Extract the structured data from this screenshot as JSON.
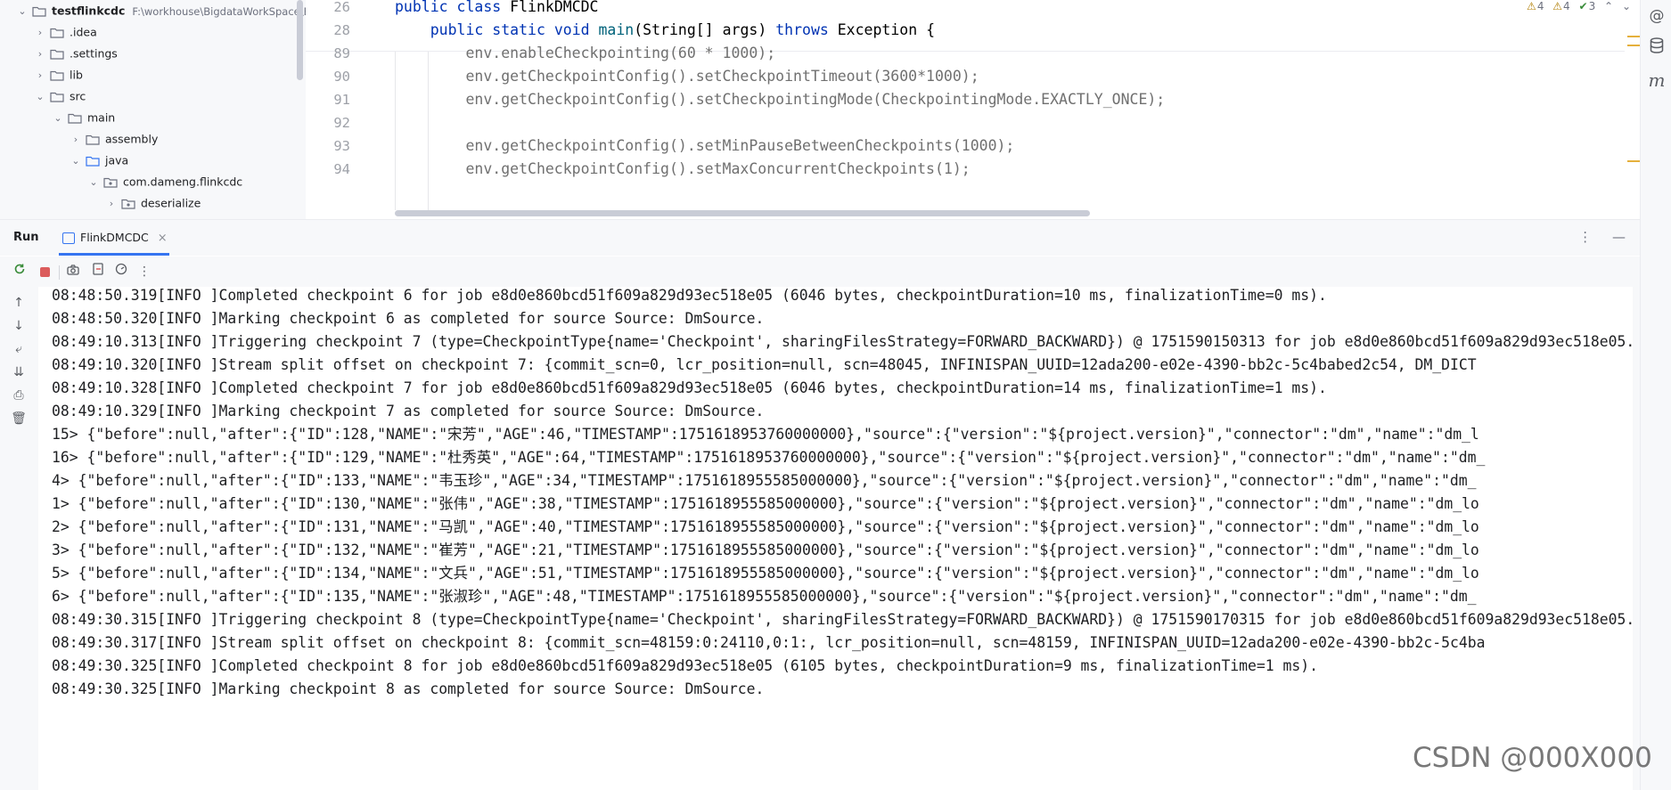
{
  "project_tree": {
    "items": [
      {
        "label": "testflinkcdc",
        "path": "F:\\workhouse\\BigdataWorkSpace\\B",
        "bold": true,
        "expanded": true,
        "kind": "module"
      },
      {
        "label": ".idea",
        "expanded": false,
        "kind": "folder"
      },
      {
        "label": ".settings",
        "expanded": false,
        "kind": "folder"
      },
      {
        "label": "lib",
        "expanded": false,
        "kind": "folder"
      },
      {
        "label": "src",
        "expanded": true,
        "kind": "folder"
      },
      {
        "label": "main",
        "expanded": true,
        "kind": "folder"
      },
      {
        "label": "assembly",
        "expanded": false,
        "kind": "folder"
      },
      {
        "label": "java",
        "expanded": true,
        "kind": "source-folder"
      },
      {
        "label": "com.dameng.flinkcdc",
        "expanded": true,
        "kind": "package"
      },
      {
        "label": "deserialize",
        "expanded": false,
        "kind": "package"
      }
    ]
  },
  "editor": {
    "lines": [
      {
        "num": "26",
        "tokens": [
          {
            "t": "public ",
            "c": "kw"
          },
          {
            "t": "class ",
            "c": "kw"
          },
          {
            "t": "FlinkDMCDC",
            "c": "cls"
          }
        ]
      },
      {
        "num": "28",
        "tokens": [
          {
            "t": "    public ",
            "c": "kw"
          },
          {
            "t": "static ",
            "c": "kw"
          },
          {
            "t": "void ",
            "c": "kw"
          },
          {
            "t": "main",
            "c": "fn"
          },
          {
            "t": "(String[] args) ",
            "c": "cls"
          },
          {
            "t": "throws ",
            "c": "kw"
          },
          {
            "t": "Exception {",
            "c": "cls"
          }
        ]
      },
      {
        "num": "89",
        "tokens": [
          {
            "t": "        env.enableCheckpointing(60 * 1000);",
            "c": "grey"
          }
        ]
      },
      {
        "num": "90",
        "tokens": [
          {
            "t": "        env.getCheckpointConfig().setCheckpointTimeout(3600*1000);",
            "c": "grey"
          }
        ]
      },
      {
        "num": "91",
        "tokens": [
          {
            "t": "        env.getCheckpointConfig().setCheckpointingMode(CheckpointingMode.EXACTLY_ONCE);",
            "c": "grey"
          }
        ]
      },
      {
        "num": "92",
        "tokens": [
          {
            "t": "",
            "c": "grey"
          }
        ]
      },
      {
        "num": "93",
        "tokens": [
          {
            "t": "        env.getCheckpointConfig().setMinPauseBetweenCheckpoints(1000);",
            "c": "grey"
          }
        ]
      },
      {
        "num": "94",
        "tokens": [
          {
            "t": "        env.getCheckpointConfig().setMaxConcurrentCheckpoints(1);",
            "c": "grey"
          }
        ]
      }
    ],
    "inspections": {
      "warnings_a": "4",
      "warnings_b": "4",
      "ok": "3"
    }
  },
  "run_window": {
    "title": "Run",
    "tab_label": "FlinkDMCDC",
    "tab_close": "×"
  },
  "console": {
    "lines": [
      "08:48:50.319[INFO ]Completed checkpoint 6 for job e8d0e860bcd51f609a829d93ec518e05 (6046 bytes, checkpointDuration=10 ms, finalizationTime=0 ms).",
      "08:48:50.320[INFO ]Marking checkpoint 6 as completed for source Source: DmSource.",
      "08:49:10.313[INFO ]Triggering checkpoint 7 (type=CheckpointType{name='Checkpoint', sharingFilesStrategy=FORWARD_BACKWARD}) @ 1751590150313 for job e8d0e860bcd51f609a829d93ec518e05.",
      "08:49:10.320[INFO ]Stream split offset on checkpoint 7: {commit_scn=0, lcr_position=null, scn=48045, INFINISPAN_UUID=12ada200-e02e-4390-bb2c-5c4babed2c54, DM_DICT",
      "08:49:10.328[INFO ]Completed checkpoint 7 for job e8d0e860bcd51f609a829d93ec518e05 (6046 bytes, checkpointDuration=14 ms, finalizationTime=1 ms).",
      "08:49:10.329[INFO ]Marking checkpoint 7 as completed for source Source: DmSource.",
      "15> {\"before\":null,\"after\":{\"ID\":128,\"NAME\":\"宋芳\",\"AGE\":46,\"TIMESTAMP\":1751618953760000000},\"source\":{\"version\":\"${project.version}\",\"connector\":\"dm\",\"name\":\"dm_l",
      "16> {\"before\":null,\"after\":{\"ID\":129,\"NAME\":\"杜秀英\",\"AGE\":64,\"TIMESTAMP\":1751618953760000000},\"source\":{\"version\":\"${project.version}\",\"connector\":\"dm\",\"name\":\"dm_",
      "4> {\"before\":null,\"after\":{\"ID\":133,\"NAME\":\"韦玉珍\",\"AGE\":34,\"TIMESTAMP\":1751618955585000000},\"source\":{\"version\":\"${project.version}\",\"connector\":\"dm\",\"name\":\"dm_",
      "1> {\"before\":null,\"after\":{\"ID\":130,\"NAME\":\"张伟\",\"AGE\":38,\"TIMESTAMP\":1751618955585000000},\"source\":{\"version\":\"${project.version}\",\"connector\":\"dm\",\"name\":\"dm_lo",
      "2> {\"before\":null,\"after\":{\"ID\":131,\"NAME\":\"马凯\",\"AGE\":40,\"TIMESTAMP\":1751618955585000000},\"source\":{\"version\":\"${project.version}\",\"connector\":\"dm\",\"name\":\"dm_lo",
      "3> {\"before\":null,\"after\":{\"ID\":132,\"NAME\":\"崔芳\",\"AGE\":21,\"TIMESTAMP\":1751618955585000000},\"source\":{\"version\":\"${project.version}\",\"connector\":\"dm\",\"name\":\"dm_lo",
      "5> {\"before\":null,\"after\":{\"ID\":134,\"NAME\":\"文兵\",\"AGE\":51,\"TIMESTAMP\":1751618955585000000},\"source\":{\"version\":\"${project.version}\",\"connector\":\"dm\",\"name\":\"dm_lo",
      "6> {\"before\":null,\"after\":{\"ID\":135,\"NAME\":\"张淑珍\",\"AGE\":48,\"TIMESTAMP\":1751618955585000000},\"source\":{\"version\":\"${project.version}\",\"connector\":\"dm\",\"name\":\"dm_",
      "08:49:30.315[INFO ]Triggering checkpoint 8 (type=CheckpointType{name='Checkpoint', sharingFilesStrategy=FORWARD_BACKWARD}) @ 1751590170315 for job e8d0e860bcd51f609a829d93ec518e05.",
      "08:49:30.317[INFO ]Stream split offset on checkpoint 8: {commit_scn=48159:0:24110,0:1:, lcr_position=null, scn=48159, INFINISPAN_UUID=12ada200-e02e-4390-bb2c-5c4ba",
      "08:49:30.325[INFO ]Completed checkpoint 8 for job e8d0e860bcd51f609a829d93ec518e05 (6105 bytes, checkpointDuration=9 ms, finalizationTime=1 ms).",
      "08:49:30.325[INFO ]Marking checkpoint 8 as completed for source Source: DmSource."
    ]
  },
  "watermark": "CSDN @000X000",
  "colors": {
    "accent": "#3574f0",
    "panel_bg": "#f7f8fa",
    "keyword": "#0033b3",
    "method": "#00627a",
    "stop": "#db5c5c"
  }
}
